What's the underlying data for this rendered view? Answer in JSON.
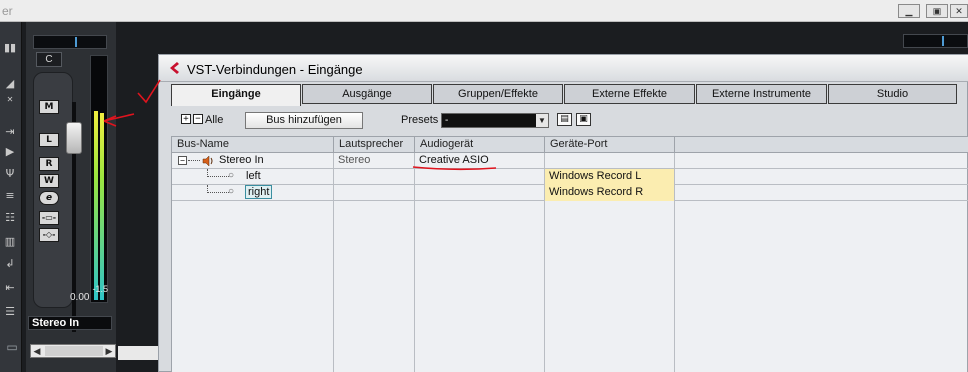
{
  "host": {
    "title_fragment": "er",
    "channel": {
      "mode_label": "C",
      "buttons": [
        "M",
        "L",
        "R",
        "W",
        "e"
      ],
      "peak_value": "-1.5",
      "fader_value": "0.00",
      "name": "Stereo In",
      "fader_level_fraction": 0.78
    }
  },
  "dialog": {
    "title": "VST-Verbindungen - Eingänge",
    "tabs": [
      {
        "label": "Eingänge",
        "active": true
      },
      {
        "label": "Ausgänge",
        "active": false
      },
      {
        "label": "Gruppen/Effekte",
        "active": false
      },
      {
        "label": "Externe Effekte",
        "active": false
      },
      {
        "label": "Externe Instrumente",
        "active": false
      },
      {
        "label": "Studio",
        "active": false
      }
    ],
    "toolbar": {
      "all_label": "Alle",
      "add_bus_label": "Bus hinzufügen",
      "presets_label": "Presets",
      "presets_value": "-"
    },
    "table": {
      "columns": [
        "Bus-Name",
        "Lautsprecher",
        "Audiogerät",
        "Geräte-Port"
      ],
      "rows": [
        {
          "bus_name": "Stereo In",
          "speaker": "Stereo",
          "device": "Creative ASIO",
          "port": ""
        },
        {
          "bus_name": "left",
          "speaker": "",
          "device": "",
          "port": "Windows Record L"
        },
        {
          "bus_name": "right",
          "speaker": "",
          "device": "",
          "port": "Windows Record R"
        }
      ]
    }
  },
  "colors": {
    "annotation_red": "#e0141e",
    "port_highlight": "#fbedb0",
    "meter_top": "#f2ee40",
    "meter_bottom": "#2fc4c8"
  }
}
